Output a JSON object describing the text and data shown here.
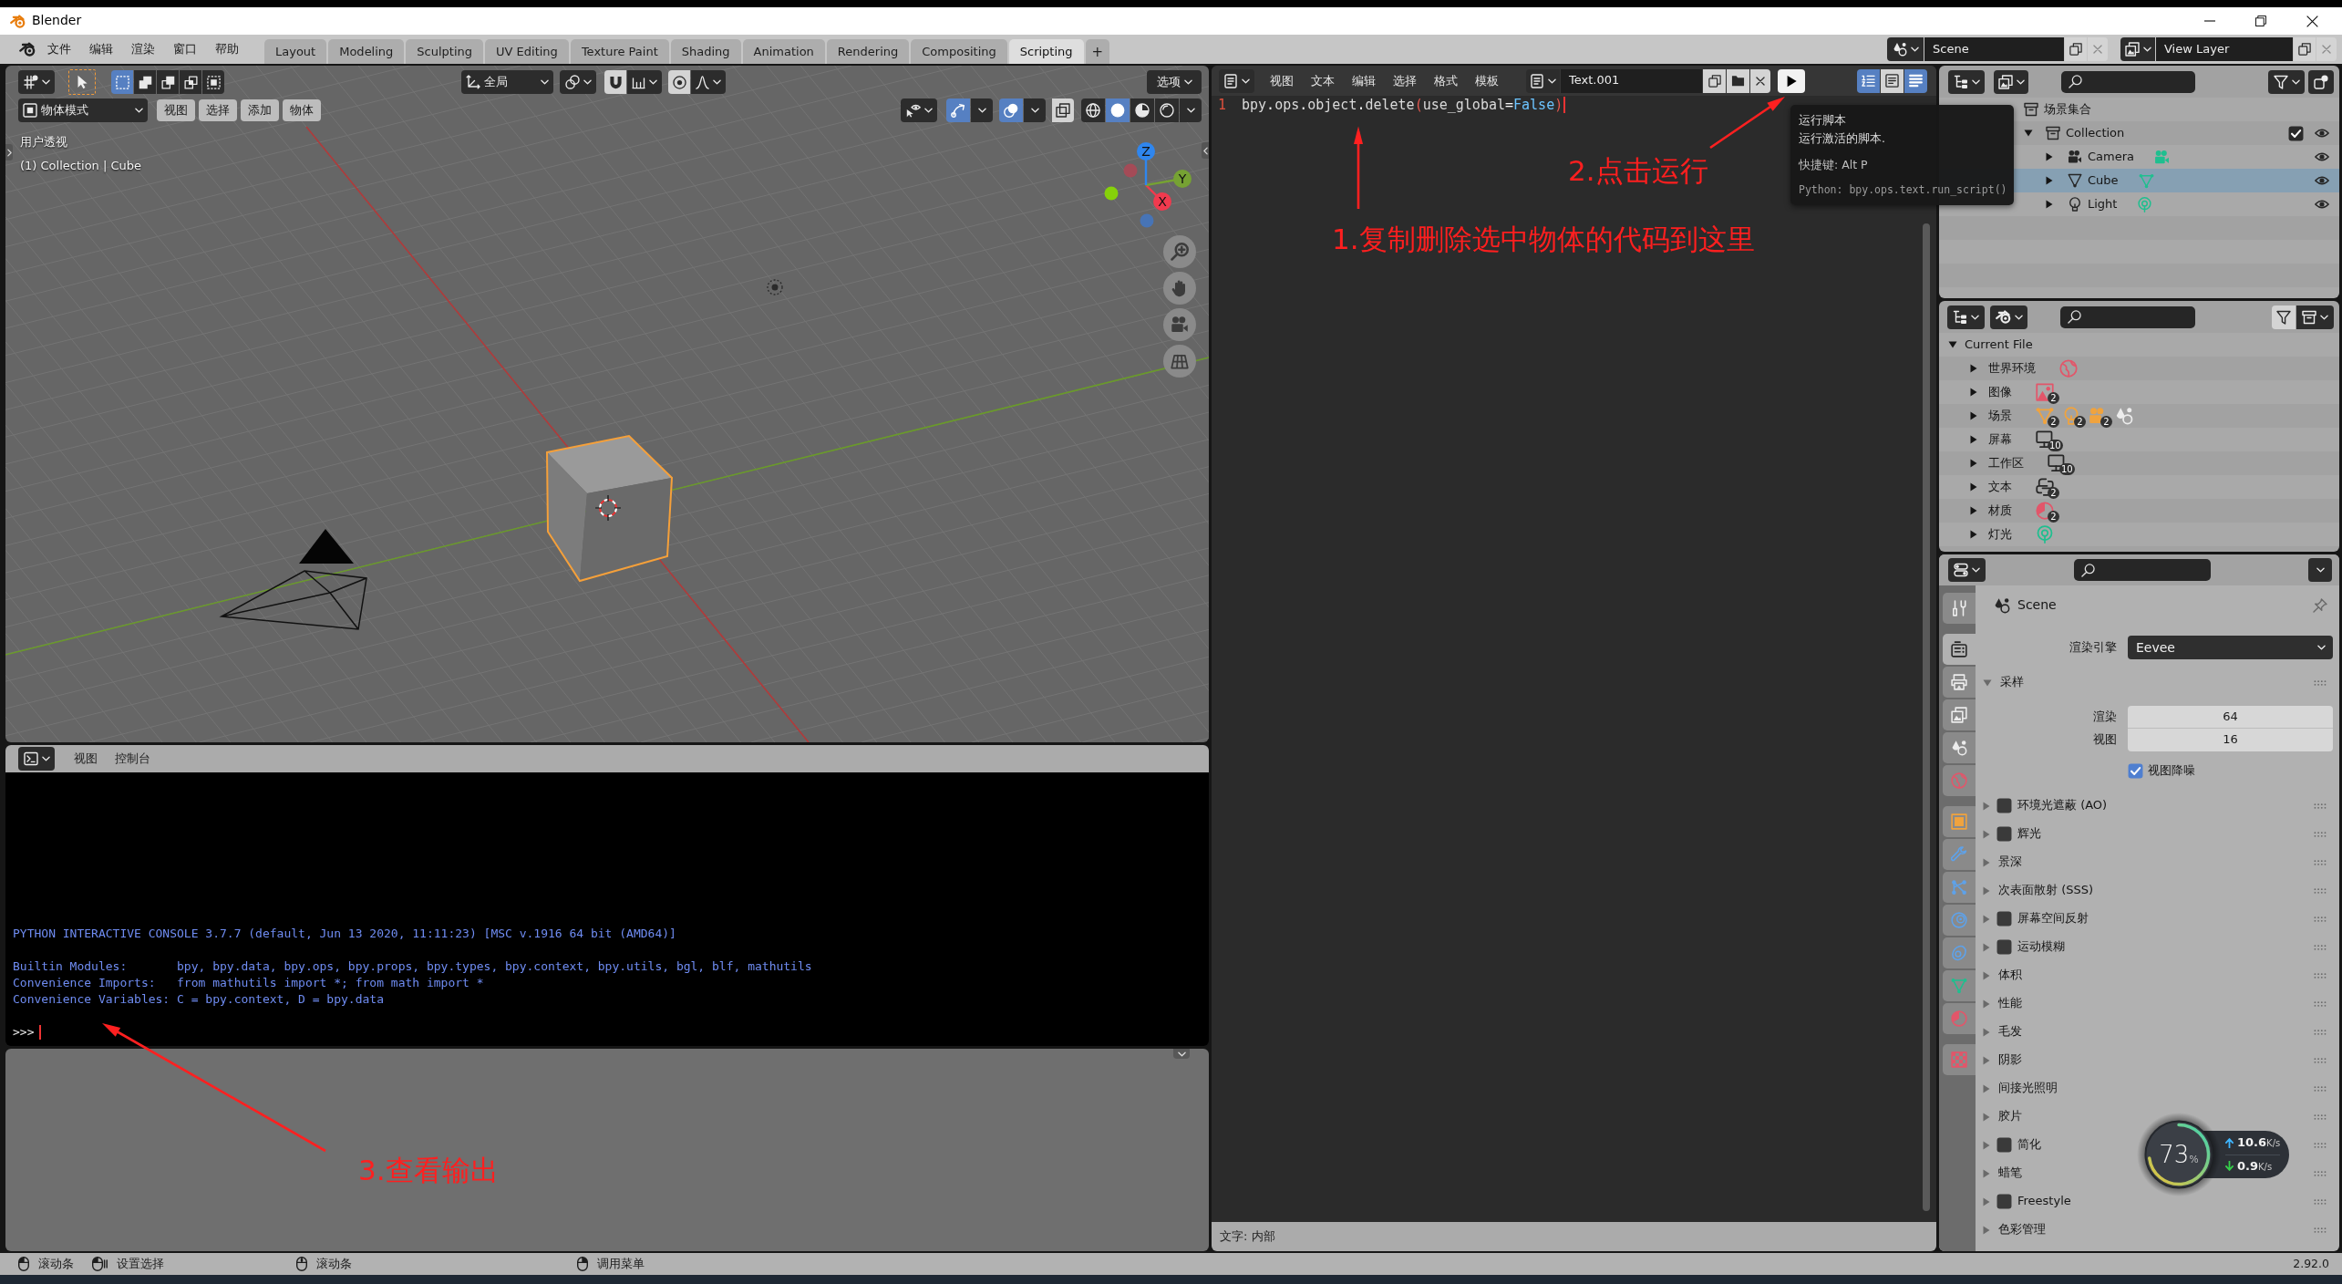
{
  "window": {
    "title": "Blender"
  },
  "topbar": {
    "menus": [
      "文件",
      "编辑",
      "渲染",
      "窗口",
      "帮助"
    ],
    "workspaces": [
      {
        "label": "Layout",
        "selected": false
      },
      {
        "label": "Modeling",
        "selected": false
      },
      {
        "label": "Sculpting",
        "selected": false
      },
      {
        "label": "UV Editing",
        "selected": false
      },
      {
        "label": "Texture Paint",
        "selected": false
      },
      {
        "label": "Shading",
        "selected": false
      },
      {
        "label": "Animation",
        "selected": false
      },
      {
        "label": "Rendering",
        "selected": false
      },
      {
        "label": "Compositing",
        "selected": false
      },
      {
        "label": "Scripting",
        "selected": true
      }
    ],
    "add_workspace": "+",
    "scene": "Scene",
    "view_layer": "View Layer"
  },
  "viewport": {
    "select_modes": [
      {
        "kind": "set",
        "selected": true
      },
      {
        "kind": "extend",
        "selected": false
      },
      {
        "kind": "subtract",
        "selected": false
      },
      {
        "kind": "difference",
        "selected": false
      },
      {
        "kind": "intersect",
        "selected": false
      }
    ],
    "orientation": "全局",
    "tool_toggles": [
      {
        "kind": "snap",
        "on": false
      },
      {
        "kind": "proportional",
        "on": false
      }
    ],
    "options": "选项",
    "mode": "物体模式",
    "menus": [
      "视图",
      "选择",
      "添加",
      "物体"
    ],
    "toggles": [
      {
        "kind": "gizmo",
        "on": true
      },
      {
        "kind": "overlay",
        "on": true
      },
      {
        "kind": "xray",
        "on": false
      }
    ],
    "shading": [
      {
        "kind": "wireframe",
        "selected": false
      },
      {
        "kind": "solid",
        "selected": true
      },
      {
        "kind": "material",
        "selected": false
      },
      {
        "kind": "rendered",
        "selected": false
      }
    ],
    "view_name": "用户透视",
    "context": "(1) Collection | Cube",
    "axes": [
      "X",
      "Y",
      "Z"
    ]
  },
  "text_editor": {
    "menus": [
      "视图",
      "文本",
      "编辑",
      "选择",
      "格式",
      "模板"
    ],
    "text_name": "Text.001",
    "display_toggles": [
      {
        "kind": "line-numbers",
        "on": true
      },
      {
        "kind": "word-wrap",
        "on": false
      },
      {
        "kind": "syntax",
        "on": true
      }
    ],
    "lines": [
      {
        "number": "1",
        "tokens": [
          {
            "text": "bpy",
            "kind": "name"
          },
          {
            "text": ".",
            "kind": "operator"
          },
          {
            "text": "ops",
            "kind": "name"
          },
          {
            "text": ".",
            "kind": "operator"
          },
          {
            "text": "object",
            "kind": "name"
          },
          {
            "text": ".",
            "kind": "operator"
          },
          {
            "text": "delete",
            "kind": "name"
          },
          {
            "text": "(",
            "kind": "bracket"
          },
          {
            "text": "use_global",
            "kind": "name"
          },
          {
            "text": "=",
            "kind": "operator"
          },
          {
            "text": "False",
            "kind": "keyword"
          },
          {
            "text": ")",
            "kind": "bracket"
          }
        ]
      }
    ],
    "footer": "文字: 内部"
  },
  "tooltip": {
    "title": "运行脚本",
    "description": "运行激活的脚本.",
    "shortcut": "快捷键: Alt P",
    "python": "Python: bpy.ops.text.run_script()"
  },
  "console": {
    "menus": [
      "视图",
      "控制台"
    ],
    "blocks": [
      [
        "PYTHON INTERACTIVE CONSOLE 3.7.7 (default, Jun 13 2020, 11:11:23) [MSC v.1916 64 bit (AMD64)]"
      ],
      [
        "Builtin Modules:       bpy, bpy.data, bpy.ops, bpy.props, bpy.types, bpy.context, bpy.utils, bgl, blf, mathutils",
        "Convenience Imports:   from mathutils import *; from math import *",
        "Convenience Variables: C = bpy.context, D = bpy.data"
      ]
    ],
    "prompt": ">>>"
  },
  "outliner": {
    "tree": [
      {
        "name": "场景集合",
        "kind": "scene-collection",
        "selected": false,
        "children": [
          {
            "name": "Collection",
            "kind": "collection",
            "expanded": true,
            "checked": true,
            "visible": true,
            "selected": false,
            "children": [
              {
                "name": "Camera",
                "kind": "camera",
                "expanded": false,
                "visible": true,
                "selected": false
              },
              {
                "name": "Cube",
                "kind": "mesh",
                "expanded": false,
                "visible": true,
                "selected": true
              },
              {
                "name": "Light",
                "kind": "light",
                "expanded": false,
                "visible": true,
                "selected": false
              }
            ]
          }
        ]
      }
    ]
  },
  "file_view": {
    "root": "Current File",
    "expanded": true,
    "rows": [
      {
        "label": "世界环境",
        "expanded": false,
        "icons": [
          {
            "kind": "world"
          }
        ]
      },
      {
        "label": "图像",
        "expanded": false,
        "icons": [
          {
            "kind": "image",
            "count": "2"
          }
        ]
      },
      {
        "label": "场景",
        "expanded": false,
        "icons": [
          {
            "kind": "mesh",
            "count": "2"
          },
          {
            "kind": "light",
            "count": "2"
          },
          {
            "kind": "camera",
            "count": "2"
          },
          {
            "kind": "scene"
          }
        ]
      },
      {
        "label": "屏幕",
        "expanded": false,
        "icons": [
          {
            "kind": "screen",
            "count": "10"
          }
        ]
      },
      {
        "label": "工作区",
        "expanded": false,
        "icons": [
          {
            "kind": "screen",
            "count": "10"
          }
        ]
      },
      {
        "label": "文本",
        "expanded": false,
        "icons": [
          {
            "kind": "python",
            "count": "2"
          }
        ]
      },
      {
        "label": "材质",
        "expanded": false,
        "icons": [
          {
            "kind": "material",
            "count": "2"
          }
        ]
      },
      {
        "label": "灯光",
        "expanded": false,
        "icons": [
          {
            "kind": "light-data"
          }
        ]
      }
    ]
  },
  "properties": {
    "tab_groups": [
      [
        {
          "kind": "tool",
          "selected": false
        }
      ],
      [
        {
          "kind": "render",
          "selected": true
        },
        {
          "kind": "output",
          "selected": false
        },
        {
          "kind": "view-layer",
          "selected": false
        },
        {
          "kind": "scene",
          "selected": false
        },
        {
          "kind": "world",
          "selected": false
        }
      ],
      [
        {
          "kind": "object",
          "selected": false
        },
        {
          "kind": "modifier",
          "selected": false
        },
        {
          "kind": "particles",
          "selected": false
        },
        {
          "kind": "physics",
          "selected": false
        },
        {
          "kind": "constraints",
          "selected": false
        },
        {
          "kind": "data",
          "selected": false
        },
        {
          "kind": "material",
          "selected": false
        }
      ],
      [
        {
          "kind": "texture",
          "selected": false
        }
      ]
    ],
    "context": "Scene",
    "engine_label": "渲染引擎",
    "engine": "Eevee",
    "panels": [
      {
        "title": "采样",
        "kind": "plain",
        "expanded": true,
        "fields": [
          {
            "label": "渲染",
            "value": "64"
          },
          {
            "label": "视图",
            "value": "16"
          }
        ],
        "checks": [
          {
            "label": "视图降噪",
            "checked": true
          }
        ]
      },
      {
        "title": "环境光遮蔽 (AO)",
        "kind": "toggle",
        "checked": false,
        "expanded": false
      },
      {
        "title": "辉光",
        "kind": "toggle",
        "checked": false,
        "expanded": false
      },
      {
        "title": "景深",
        "kind": "plain",
        "expanded": false
      },
      {
        "title": "次表面散射 (SSS)",
        "kind": "plain",
        "expanded": false
      },
      {
        "title": "屏幕空间反射",
        "kind": "toggle",
        "checked": false,
        "expanded": false
      },
      {
        "title": "运动模糊",
        "kind": "toggle",
        "checked": false,
        "expanded": false
      },
      {
        "title": "体积",
        "kind": "plain",
        "expanded": false
      },
      {
        "title": "性能",
        "kind": "plain",
        "expanded": false
      },
      {
        "title": "毛发",
        "kind": "plain",
        "expanded": false
      },
      {
        "title": "阴影",
        "kind": "plain",
        "expanded": false
      },
      {
        "title": "间接光照明",
        "kind": "plain",
        "expanded": false
      },
      {
        "title": "胶片",
        "kind": "plain",
        "expanded": false
      },
      {
        "title": "简化",
        "kind": "toggle",
        "checked": false,
        "expanded": false
      },
      {
        "title": "蜡笔",
        "kind": "plain",
        "expanded": false
      },
      {
        "title": "Freestyle",
        "kind": "toggle",
        "checked": false,
        "expanded": false
      },
      {
        "title": "色彩管理",
        "kind": "plain",
        "expanded": false
      }
    ]
  },
  "status_bar": {
    "hints": [
      {
        "kind": "mouse-left",
        "label": "滚动条"
      },
      {
        "kind": "mouse-drag",
        "label": "设置选择"
      },
      {
        "kind": "mouse-middle",
        "label": "滚动条"
      },
      {
        "kind": "mouse-right",
        "label": "调用菜单"
      }
    ],
    "version": "2.92.0"
  },
  "net_monitor": {
    "percent": "73",
    "percent_unit": "%",
    "upload": {
      "value": "10.6",
      "unit": "K/s"
    },
    "download": {
      "value": "0.9",
      "unit": "K/s"
    }
  },
  "annotations": [
    "2.点击运行",
    "1.复制删除选中物体的代码到这里",
    "3.查看输出"
  ]
}
